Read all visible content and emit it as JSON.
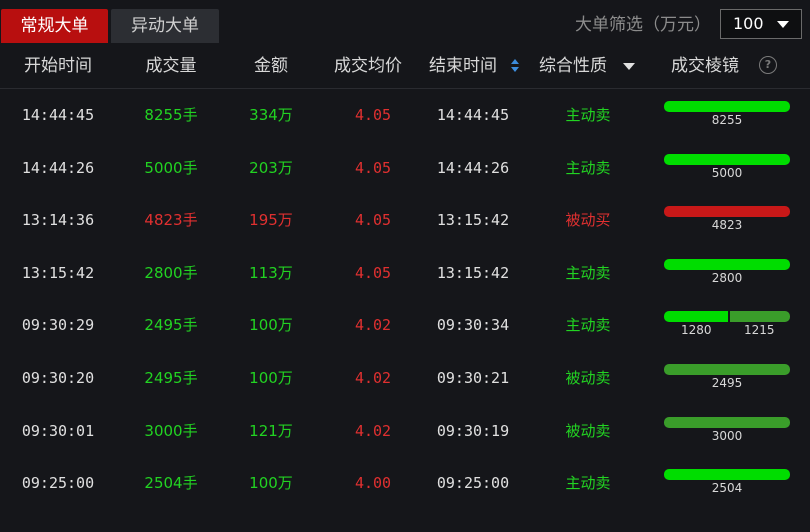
{
  "tabs": {
    "active": "常规大单",
    "inactive": "异动大单"
  },
  "filter": {
    "label": "大单筛选（万元）",
    "value": "100"
  },
  "columns": [
    "开始时间",
    "成交量",
    "金额",
    "成交均价",
    "结束时间",
    "综合性质",
    "成交棱镜"
  ],
  "colors": {
    "bright_green": "#00dd00",
    "dark_green": "#3a9d2a",
    "red": "#c81818"
  },
  "rows": [
    {
      "start": "14:44:45",
      "volume": "8255手",
      "amount": "334万",
      "price": "4.05",
      "end": "14:44:45",
      "nature": "主动卖",
      "color": "green",
      "bar": [
        {
          "value": "8255",
          "fraction": 1.0,
          "color": "#00dd00"
        }
      ]
    },
    {
      "start": "14:44:26",
      "volume": "5000手",
      "amount": "203万",
      "price": "4.05",
      "end": "14:44:26",
      "nature": "主动卖",
      "color": "green",
      "bar": [
        {
          "value": "5000",
          "fraction": 1.0,
          "color": "#00dd00"
        }
      ]
    },
    {
      "start": "13:14:36",
      "volume": "4823手",
      "amount": "195万",
      "price": "4.05",
      "end": "13:15:42",
      "nature": "被动买",
      "color": "red",
      "bar": [
        {
          "value": "4823",
          "fraction": 1.0,
          "color": "#c81818"
        }
      ]
    },
    {
      "start": "13:15:42",
      "volume": "2800手",
      "amount": "113万",
      "price": "4.05",
      "end": "13:15:42",
      "nature": "主动卖",
      "color": "green",
      "bar": [
        {
          "value": "2800",
          "fraction": 1.0,
          "color": "#00dd00"
        }
      ]
    },
    {
      "start": "09:30:29",
      "volume": "2495手",
      "amount": "100万",
      "price": "4.02",
      "end": "09:30:34",
      "nature": "主动卖",
      "color": "green",
      "bar": [
        {
          "value": "1280",
          "fraction": 0.513,
          "color": "#00dd00"
        },
        {
          "value": "1215",
          "fraction": 0.487,
          "color": "#3a9d2a"
        }
      ]
    },
    {
      "start": "09:30:20",
      "volume": "2495手",
      "amount": "100万",
      "price": "4.02",
      "end": "09:30:21",
      "nature": "被动卖",
      "color": "green",
      "bar": [
        {
          "value": "2495",
          "fraction": 1.0,
          "color": "#3a9d2a"
        }
      ]
    },
    {
      "start": "09:30:01",
      "volume": "3000手",
      "amount": "121万",
      "price": "4.02",
      "end": "09:30:19",
      "nature": "被动卖",
      "color": "green",
      "bar": [
        {
          "value": "3000",
          "fraction": 1.0,
          "color": "#3a9d2a"
        }
      ]
    },
    {
      "start": "09:25:00",
      "volume": "2504手",
      "amount": "100万",
      "price": "4.00",
      "end": "09:25:00",
      "nature": "主动卖",
      "color": "green",
      "bar": [
        {
          "value": "2504",
          "fraction": 1.0,
          "color": "#00dd00"
        }
      ]
    }
  ]
}
